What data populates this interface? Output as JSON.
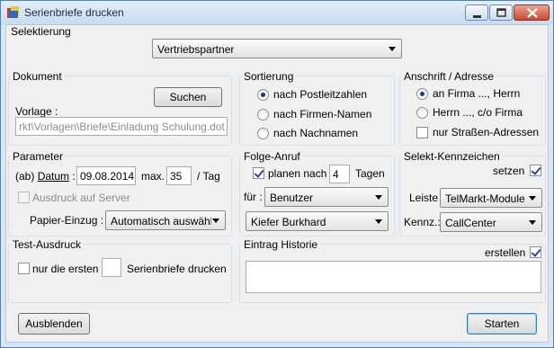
{
  "window": {
    "title": "Serienbriefe drucken",
    "minimize": "minimize",
    "maximize": "maximize",
    "close": "close"
  },
  "selektierung": {
    "title": "Selektierung",
    "value": "Vertriebspartner"
  },
  "dokument": {
    "title": "Dokument",
    "suchen": "Suchen",
    "vorlage_label": "Vorlage :",
    "vorlage_value": "rkt\\Vorlagen\\Briefe\\Einladung Schulung.dot"
  },
  "sortierung": {
    "title": "Sortierung",
    "options": [
      "nach Postleitzahlen",
      "nach Firmen-Namen",
      "nach Nachnamen"
    ],
    "selected": 0
  },
  "anschrift": {
    "title": "Anschrift / Adresse",
    "options": [
      "an Firma ..., Herrn",
      "Herrn ..., c/o Firma"
    ],
    "selected": 0,
    "nur_strassen": "nur Straßen-Adressen"
  },
  "parameter": {
    "title": "Parameter",
    "datum_label_prefix": "(ab) ",
    "datum_label": "Datum",
    "datum_colon": " :",
    "datum_value": "09.08.2014",
    "max_label": "max.",
    "max_value": "35",
    "per_tag": "/ Tag",
    "ausdruck_server": "Ausdruck auf Server",
    "papier_label": "Papier-Einzug :",
    "papier_value": "Automatisch auswähl"
  },
  "folge": {
    "title": "Folge-Anruf",
    "planen_label": "planen nach",
    "tage_value": "4",
    "tage_label": "Tagen",
    "fuer_label": "für :",
    "benutzer_value": "Benutzer",
    "person_value": "Kiefer Burkhard"
  },
  "kennzeichen": {
    "title": "Selekt-Kennzeichen",
    "setzen": "setzen",
    "leiste_label": "Leiste :",
    "leiste_value": "TelMarkt-Module",
    "kennz_label": "Kennz.:",
    "kennz_value": "CallCenter"
  },
  "test": {
    "title": "Test-Ausdruck",
    "nur_label": "nur die ersten",
    "count_value": "",
    "suffix": "Serienbriefe drucken"
  },
  "historie": {
    "title": "Eintrag Historie",
    "erstellen": "erstellen",
    "value": ""
  },
  "footer": {
    "ausblenden": "Ausblenden",
    "starten": "Starten"
  }
}
